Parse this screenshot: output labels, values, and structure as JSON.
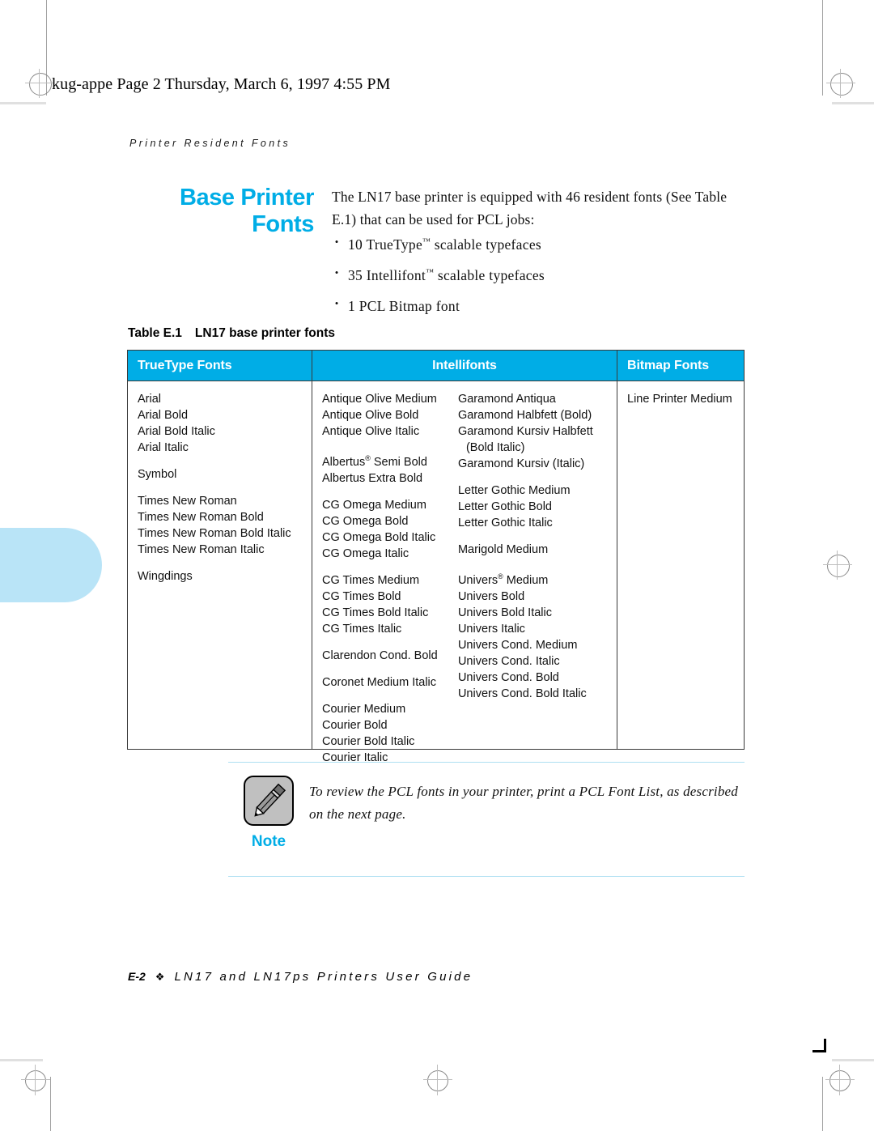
{
  "file_header": "kug-appe  Page 2  Thursday, March 6, 1997  4:55 PM",
  "running_head": "Printer Resident Fonts",
  "chapter": {
    "title_line1": "Base Printer",
    "title_line2": "Fonts"
  },
  "intro": {
    "paragraph": "The LN17 base printer is equipped with 46 resident fonts (See Table E.1) that can be used for PCL jobs:",
    "bullets": [
      {
        "dot": "•",
        "pre": "10 TrueType",
        "sup": "™",
        "post": " scalable typefaces"
      },
      {
        "dot": "•",
        "pre": "35 Intellifont",
        "sup": "™",
        "post": " scalable typefaces"
      },
      {
        "dot": "•",
        "pre": "1 PCL Bitmap font",
        "sup": "",
        "post": ""
      }
    ]
  },
  "table": {
    "caption_number": "Table E.1",
    "caption_text": "LN17 base printer fonts",
    "headers": {
      "truetype": "TrueType Fonts",
      "intellifonts": "Intellifonts",
      "bitmap": "Bitmap Fonts"
    },
    "truetype_groups": [
      [
        "Arial",
        "Arial Bold",
        "Arial Bold Italic",
        "Arial Italic"
      ],
      [
        "Symbol"
      ],
      [
        "Times New Roman",
        "Times New Roman Bold",
        "Times New Roman Bold Italic",
        "Times New Roman Italic"
      ],
      [
        "Wingdings"
      ]
    ],
    "intellifonts_col_a": [
      [
        "Antique Olive Medium",
        "Antique Olive Bold",
        "Antique Olive Italic"
      ],
      [
        "Albertus® Semi Bold",
        "Albertus Extra Bold"
      ],
      [
        "CG Omega Medium",
        "CG Omega Bold",
        "CG Omega Bold Italic",
        "CG Omega Italic"
      ],
      [
        "CG Times Medium",
        "CG Times Bold",
        "CG Times Bold Italic",
        "CG Times Italic"
      ],
      [
        "Clarendon Cond. Bold"
      ],
      [
        "Coronet Medium Italic"
      ],
      [
        "Courier Medium",
        "Courier Bold",
        "Courier Bold Italic",
        "Courier Italic"
      ]
    ],
    "intellifonts_col_b": [
      [
        "Garamond Antiqua",
        "Garamond Halbfett (Bold)",
        "Garamond Kursiv Halbfett",
        "  (Bold Italic)",
        "Garamond Kursiv (Italic)"
      ],
      [
        "Letter Gothic Medium",
        "Letter Gothic Bold",
        "Letter Gothic Italic"
      ],
      [
        "Marigold Medium"
      ],
      [
        "Univers® Medium",
        "Univers Bold",
        "Univers Bold Italic",
        "Univers Italic",
        "Univers Cond. Medium",
        "Univers Cond. Italic",
        "Univers Cond. Bold",
        "Univers Cond. Bold Italic"
      ]
    ],
    "bitmap_fonts": [
      "Line Printer Medium"
    ]
  },
  "note": {
    "label": "Note",
    "text": "To review the PCL fonts in your printer, print a PCL Font List, as described on the next page."
  },
  "footer": {
    "page": "E-2",
    "diamond": "❖",
    "title": "LN17 and LN17ps Printers User Guide"
  },
  "colors": {
    "accent_cyan": "#00ade6",
    "tab_blue": "#b9e4f7",
    "note_icon_gray": "#c0c0c0"
  }
}
